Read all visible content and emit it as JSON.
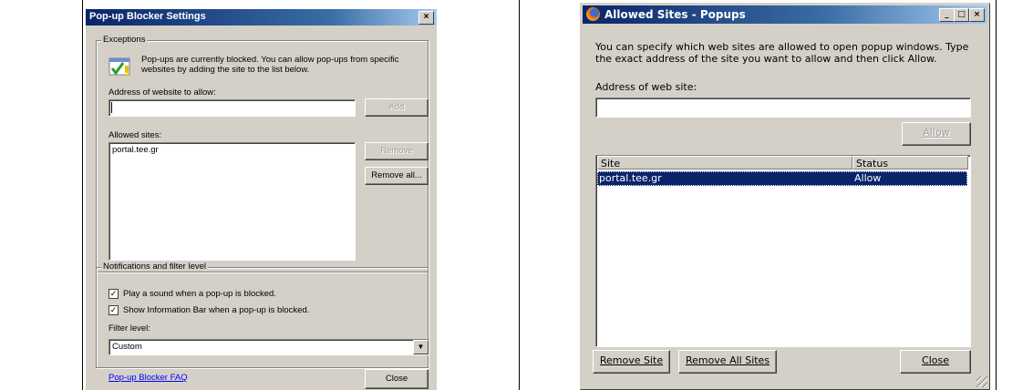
{
  "ie_dialog": {
    "title": "Pop-up Blocker Settings",
    "close_glyph": "×",
    "exceptions_label": "Exceptions",
    "exceptions_text_1": "Pop-ups are currently blocked.  You can allow pop-ups from specific",
    "exceptions_text_2": "websites by adding the site to the list below.",
    "address_label": "Address of website to allow:",
    "address_value": "",
    "add_button": "Add",
    "allowed_label": "Allowed sites:",
    "allowed_sites": [
      "portal.tee.gr"
    ],
    "remove_button": "Remove",
    "remove_all_button": "Remove all...",
    "notifications_label": "Notifications and filter level",
    "play_sound_label": "Play a sound when a pop-up is blocked.",
    "play_sound_checked": true,
    "info_bar_label": "Show Information Bar when a pop-up is blocked.",
    "info_bar_checked": true,
    "filter_label": "Filter level:",
    "filter_value": "Custom",
    "faq_link": "Pop-up Blocker FAQ",
    "close_button": "Close"
  },
  "ff_dialog": {
    "title": "Allowed Sites - Popups",
    "description_1": "You can specify which web sites are allowed to open popup windows. Type",
    "description_2": "the exact address of the site you want to allow and then click Allow.",
    "address_label": "Address of web site:",
    "address_value": "",
    "allow_button": "Allow",
    "columns": [
      "Site",
      "Status"
    ],
    "rows": [
      {
        "site": "portal.tee.gr",
        "status": "Allow"
      }
    ],
    "remove_site_button": "Remove Site",
    "remove_all_button": "Remove All Sites",
    "close_button": "Close"
  }
}
